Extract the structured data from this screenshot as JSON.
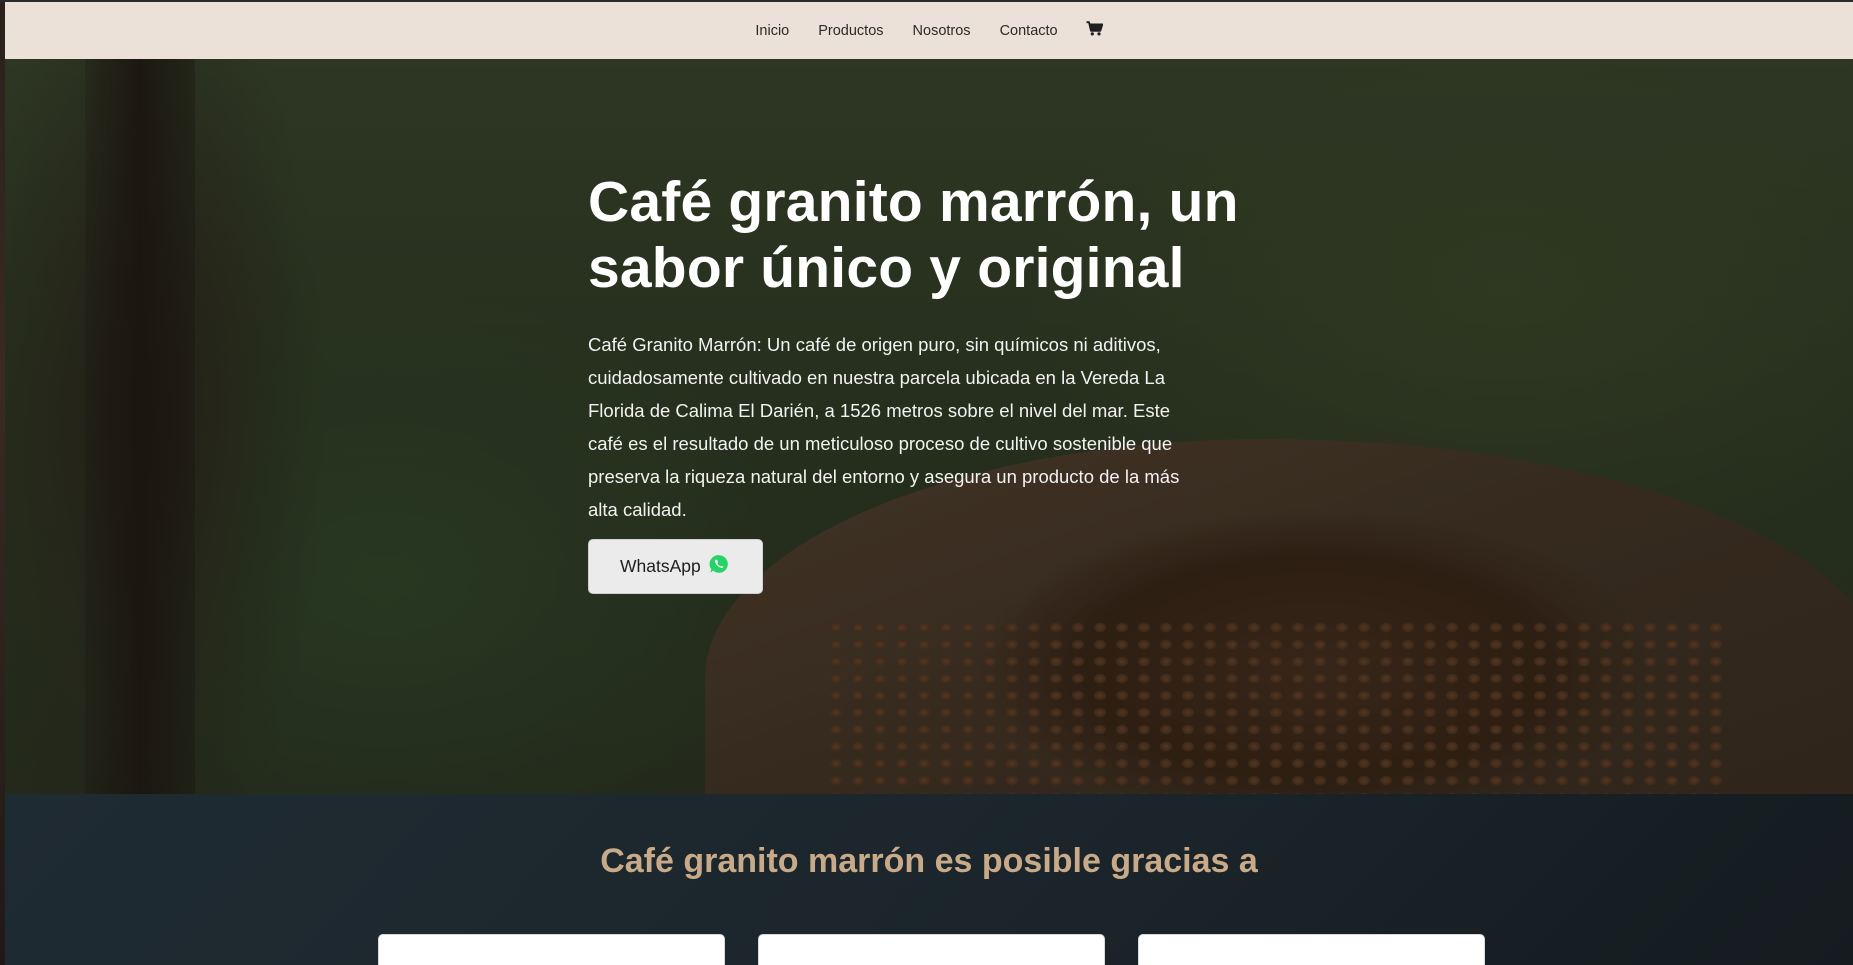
{
  "nav": {
    "items": [
      {
        "label": "Inicio"
      },
      {
        "label": "Productos"
      },
      {
        "label": "Nosotros"
      },
      {
        "label": "Contacto"
      }
    ],
    "cart_icon": "shopping-cart-icon"
  },
  "hero": {
    "title": "Café granito marrón, un sabor único y original",
    "description": "Café Granito Marrón: Un café de origen puro, sin químicos ni aditivos, cuidadosamente cultivado en nuestra parcela ubicada en la Vereda La Florida de Calima El Darién, a 1526 metros sobre el nivel del mar. Este café es el resultado de un meticuloso proceso de cultivo sostenible que preserva la riqueza natural del entorno y asegura un producto de la más alta calidad.",
    "button_label": "WhatsApp",
    "button_icon": "whatsapp-icon"
  },
  "section2": {
    "title": "Café granito marrón es posible gracias a"
  },
  "colors": {
    "navbar_bg": "#ebe1d8",
    "accent_title": "#c8aa88",
    "whatsapp_green": "#25d366",
    "section_bg": "#1f2b33"
  }
}
